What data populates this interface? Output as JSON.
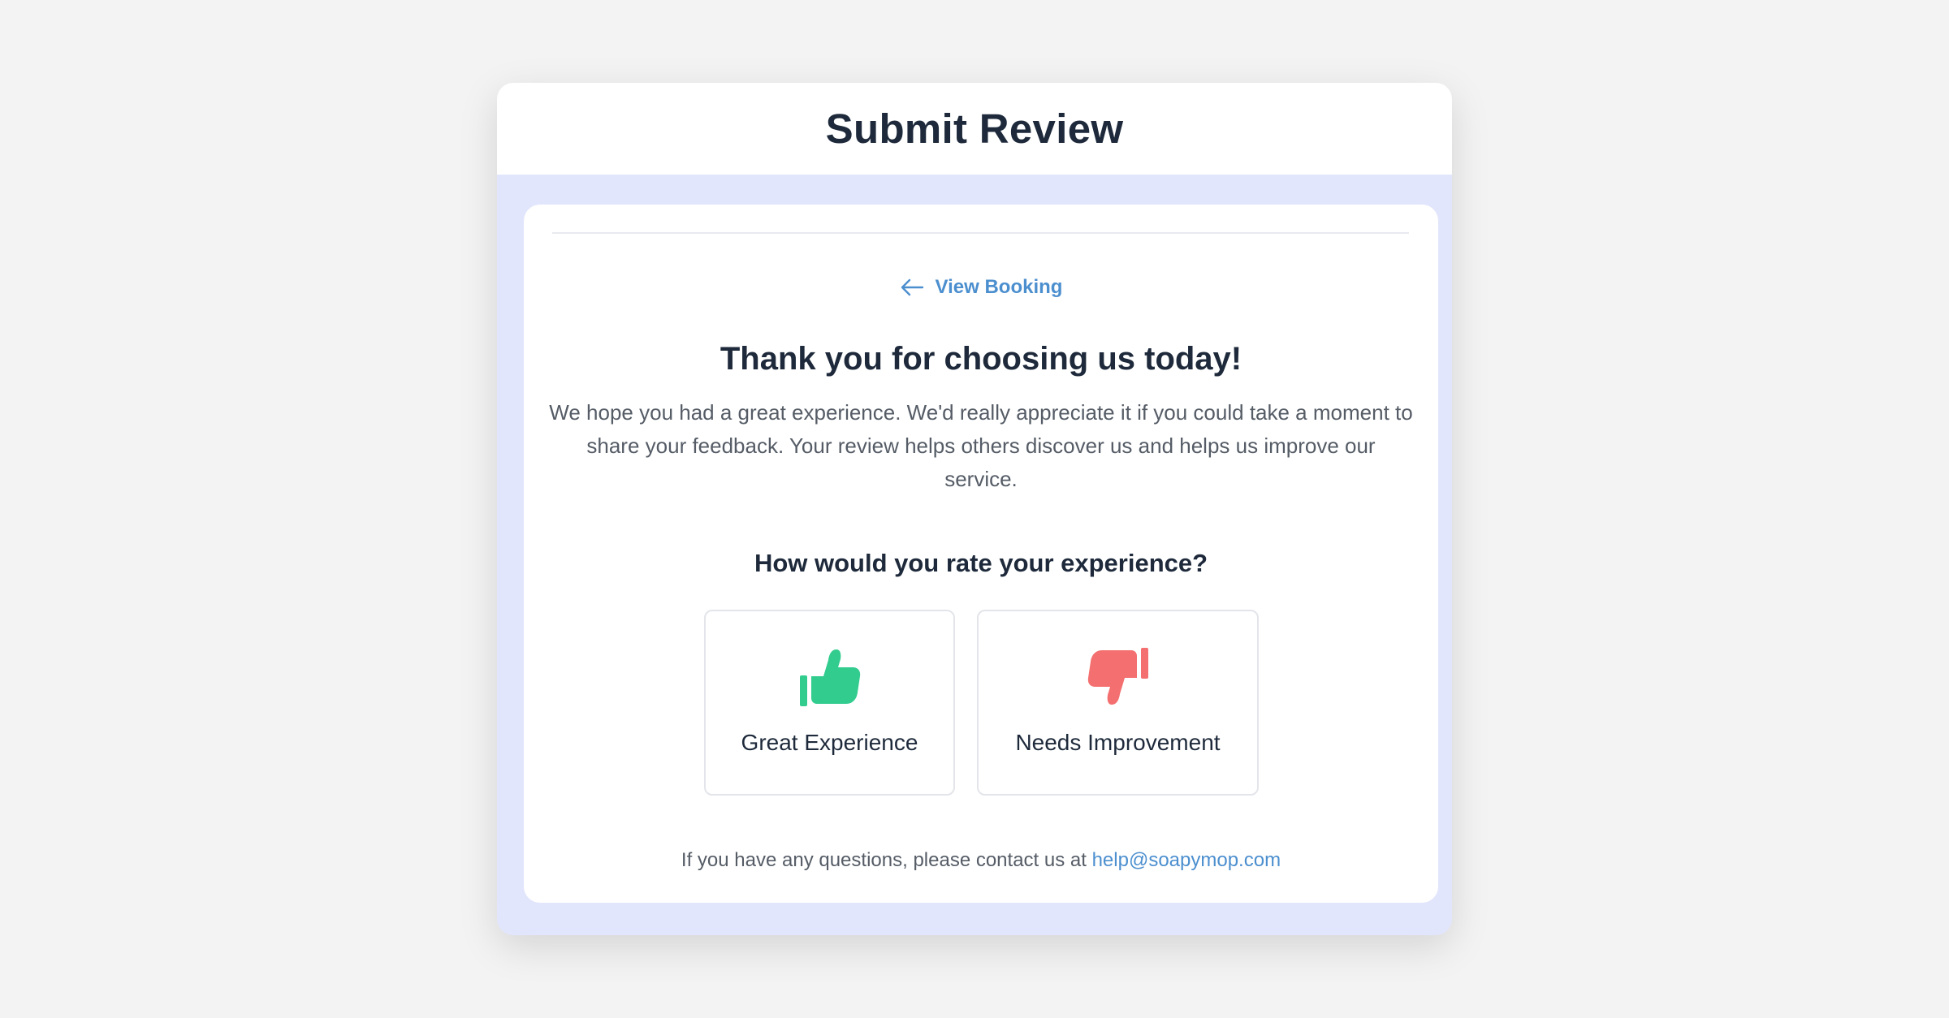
{
  "header": {
    "title": "Submit Review"
  },
  "card": {
    "back_link_label": "View Booking",
    "back_link_icon": "arrow-left-icon",
    "heading": "Thank you for choosing us today!",
    "intro": "We hope you had a great experience. We'd really appreciate it if you could take a moment to share your feedback. Your review helps others discover us and helps us improve our service.",
    "question": "How would you rate your experience?",
    "options": [
      {
        "label": "Great Experience",
        "icon": "thumbs-up-icon",
        "color": "#33cc8f"
      },
      {
        "label": "Needs Improvement",
        "icon": "thumbs-down-icon",
        "color": "#f46f6f"
      }
    ],
    "footer_text": "If you have any questions, please contact us at",
    "footer_email": "help@soapymop.com"
  },
  "colors": {
    "page_background": "#f3f3f3",
    "window_background": "#e2e6fc",
    "accent_link": "#4c8fcf",
    "heading_text": "#1e2a3b",
    "body_text": "#555c66"
  }
}
